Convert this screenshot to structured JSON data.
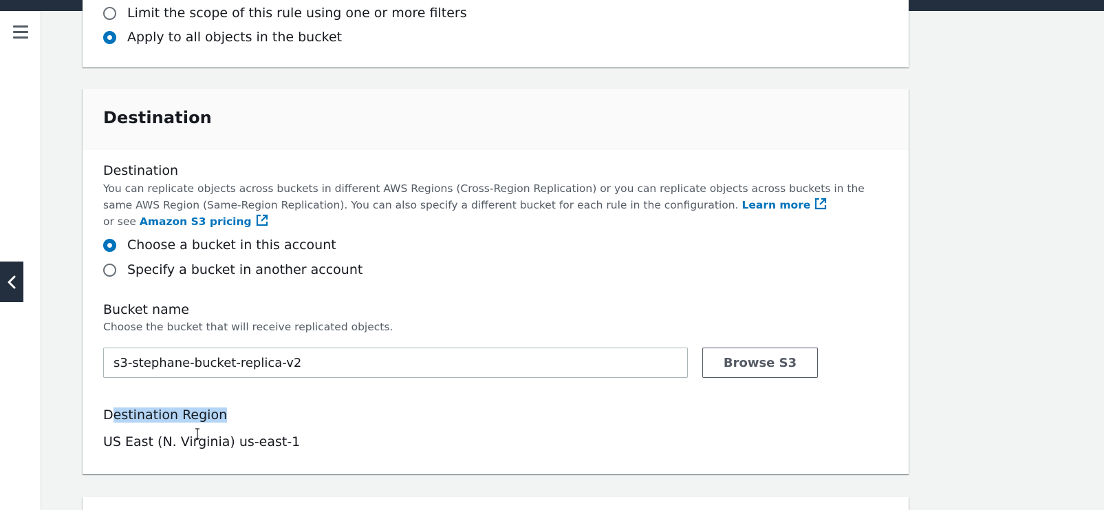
{
  "top_panel": {
    "radio_filters_label": "Limit the scope of this rule using one or more filters",
    "radio_all_label": "Apply to all objects in the bucket"
  },
  "destination_panel": {
    "title": "Destination",
    "destination_label": "Destination",
    "destination_description_part1": "You can replicate objects across buckets in different AWS Regions (Cross-Region Replication) or you can replicate objects across buckets in the same AWS Region (Same-Region Replication). You can also specify a different bucket for each rule in the configuration.",
    "learn_more_link": "Learn more",
    "or_see_text": "or see",
    "pricing_link": "Amazon S3 pricing",
    "radio_this_account_label": "Choose a bucket in this account",
    "radio_other_account_label": "Specify a bucket in another account",
    "bucket_name_label": "Bucket name",
    "bucket_name_description": "Choose the bucket that will receive replicated objects.",
    "bucket_name_value": "s3-stephane-bucket-replica-v2",
    "browse_button_label": "Browse S3",
    "region_label_first_char": "D",
    "region_label_selected": "estination Region",
    "region_value": "US East (N. Virginia) us-east-1"
  },
  "icons": {
    "menu": "hamburger-menu-icon",
    "collapse": "chevron-left-icon",
    "external_link": "external-link-icon"
  },
  "colors": {
    "accent": "#0073bb",
    "topbar": "#232f3e",
    "selection": "#b4d5f5"
  }
}
